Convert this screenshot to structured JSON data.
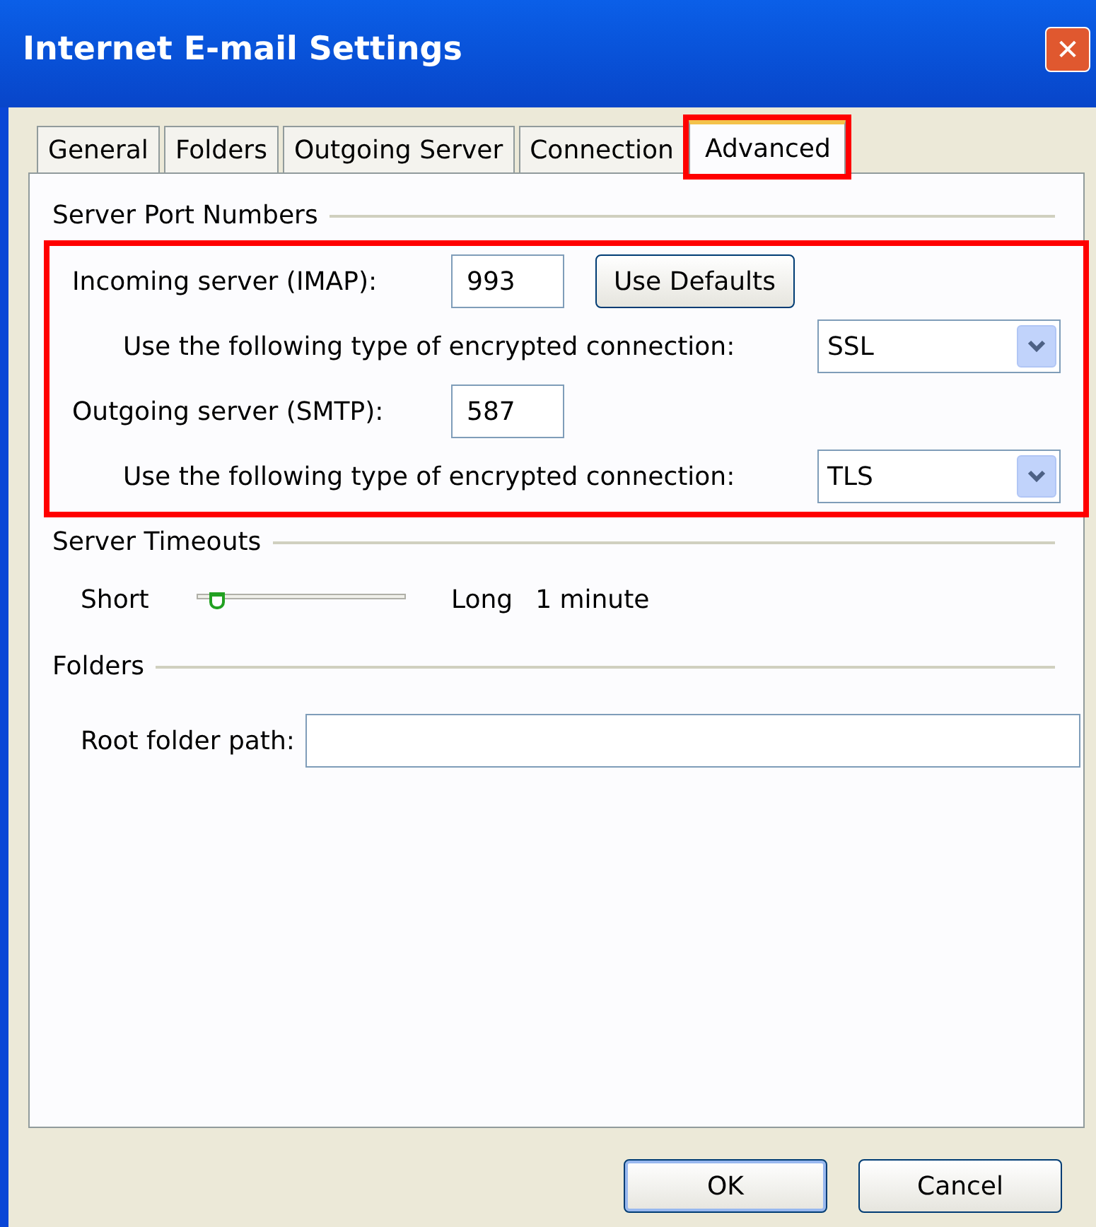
{
  "window": {
    "title": "Internet E-mail Settings",
    "close": "✕"
  },
  "tabs": [
    {
      "label": "General",
      "selected": false,
      "highlighted": false
    },
    {
      "label": "Folders",
      "selected": false,
      "highlighted": false
    },
    {
      "label": "Outgoing Server",
      "selected": false,
      "highlighted": false
    },
    {
      "label": "Connection",
      "selected": false,
      "highlighted": false
    },
    {
      "label": "Advanced",
      "selected": true,
      "highlighted": true
    }
  ],
  "server_ports": {
    "heading": "Server Port Numbers",
    "highlighted": true,
    "incoming": {
      "label": "Incoming server (IMAP):",
      "value": "993",
      "button": "Use Defaults",
      "encryption_label": "Use the following type of encrypted connection:",
      "encryption": "SSL"
    },
    "outgoing": {
      "label": "Outgoing server (SMTP):",
      "value": "587",
      "encryption_label": "Use the following type of encrypted connection:",
      "encryption": "TLS"
    }
  },
  "timeouts": {
    "heading": "Server Timeouts",
    "min_label": "Short",
    "max_label": "Long",
    "level": 0.08,
    "reading": "1 minute"
  },
  "folders": {
    "heading": "Folders",
    "root_label": "Root folder path:"
  },
  "buttons": [
    {
      "label": "OK",
      "default": true
    },
    {
      "label": "Cancel",
      "default": false
    }
  ]
}
